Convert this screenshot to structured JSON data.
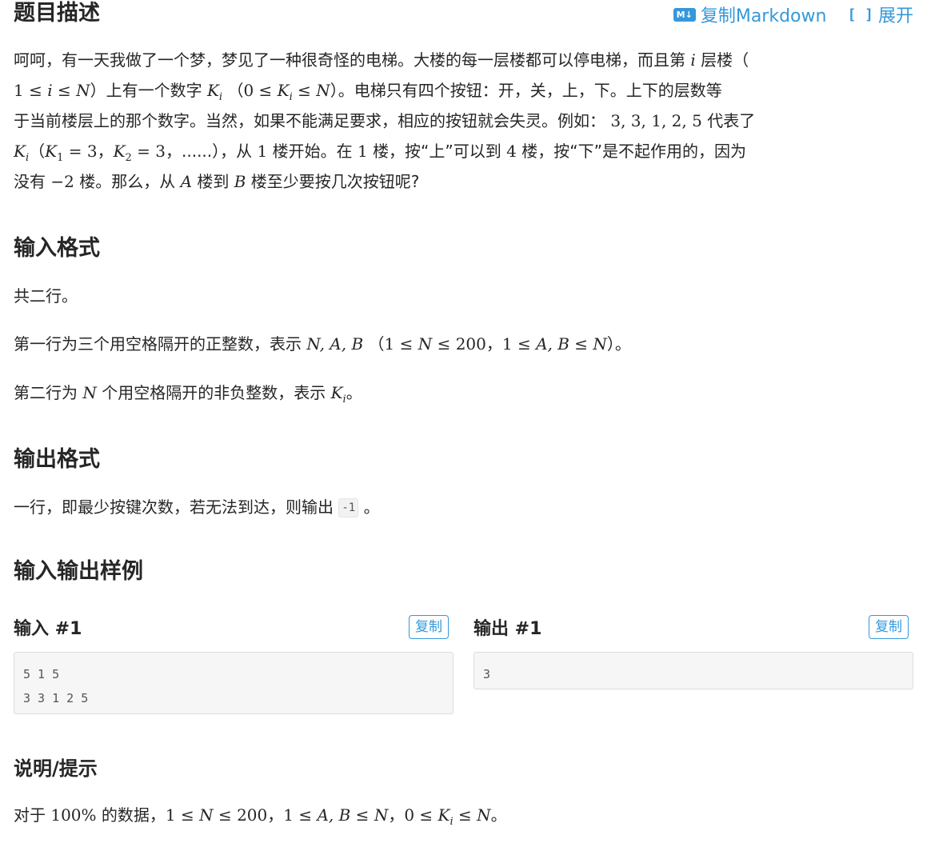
{
  "toolbar": {
    "md_icon": "M↓",
    "copy_markdown_label": "复制Markdown",
    "expand_icon": "[ ]",
    "expand_label": "展开"
  },
  "sections": {
    "description_title": "题目描述",
    "input_format_title": "输入格式",
    "output_format_title": "输出格式",
    "samples_title": "输入输出样例",
    "hint_title": "说明/提示"
  },
  "description": {
    "l1_a": "呵呵，有一天我做了一个梦，梦见了一种很奇怪的电梯。大楼的每一层楼都可以停电梯，而且第",
    "l1_i": "i",
    "l1_b": "层楼（",
    "l2_a": "1 ≤ ",
    "l2_i": "i",
    "l2_b": " ≤ ",
    "l2_N": "N",
    "l2_c": "）上有一个数字",
    "l2_K": "K",
    "l2_Ki": "i",
    "l2_d": "（",
    "l2_e": "0 ≤ ",
    "l2_K2": "K",
    "l2_K2i": "i",
    "l2_f": " ≤ ",
    "l2_N2": "N",
    "l2_g": "）。电梯只有四个按钮：开，关，上，下。上下的层数等",
    "l3_a": "于当前楼层上的那个数字。当然，如果不能满足要求，相应的按钮就会失灵。例如：",
    "l3_nums": "3, 3, 1, 2, 5",
    "l3_b": "代表了",
    "l4_K": "K",
    "l4_Ki": "i",
    "l4_a": "（",
    "l4_K1": "K",
    "l4_K1s": "1",
    "l4_eq1": " = 3",
    "l4_sep": "，",
    "l4_K2": "K",
    "l4_K2s": "2",
    "l4_eq2": " = 3",
    "l4_b": "，......），从",
    "l4_one": "1",
    "l4_c": "楼开始。在",
    "l4_one2": "1",
    "l4_d": "楼，按“上”可以到",
    "l4_four": "4",
    "l4_e": "楼，按“下”是不起作用的，因为",
    "l5_a": "没有",
    "l5_m2": "−2",
    "l5_b": "楼。那么，从",
    "l5_A": "A",
    "l5_c": "楼到",
    "l5_B": "B",
    "l5_d": "楼至少要按几次按钮呢?"
  },
  "input_format": {
    "p1": "共二行。",
    "p2_a": "第一行为三个用空格隔开的正整数，表示",
    "p2_vars": "N, A, B",
    "p2_b": "（",
    "p2_c1": "1 ≤ ",
    "p2_N": "N",
    "p2_c2": " ≤ 200",
    "p2_sep": "，",
    "p2_d1": "1 ≤ ",
    "p2_AB": "A, B",
    "p2_d2": " ≤ ",
    "p2_N2": "N",
    "p2_e": "）。",
    "p3_a": "第二行为",
    "p3_N": "N",
    "p3_b": "个用空格隔开的非负整数，表示",
    "p3_K": "K",
    "p3_Ki": "i",
    "p3_c": "。"
  },
  "output_format": {
    "p_a": "一行，即最少按键次数，若无法到达，则输出",
    "p_code": "-1",
    "p_b": "。"
  },
  "samples": {
    "input_title": "输入 #1",
    "output_title": "输出 #1",
    "copy_label": "复制",
    "input_value": "5 1 5\n3 3 1 2 5",
    "output_value": "3"
  },
  "hint": {
    "a": "对于",
    "pct": "100%",
    "b": "的数据，",
    "c1": "1 ≤ ",
    "N": "N",
    "c2": " ≤ 200",
    "sep1": "，",
    "d1": "1 ≤ ",
    "AB": "A, B",
    "d2": " ≤ ",
    "N2": "N",
    "sep2": "，",
    "e1": "0 ≤ ",
    "K": "K",
    "Ki": "i",
    "e2": " ≤ ",
    "N3": "N",
    "f": "。"
  }
}
